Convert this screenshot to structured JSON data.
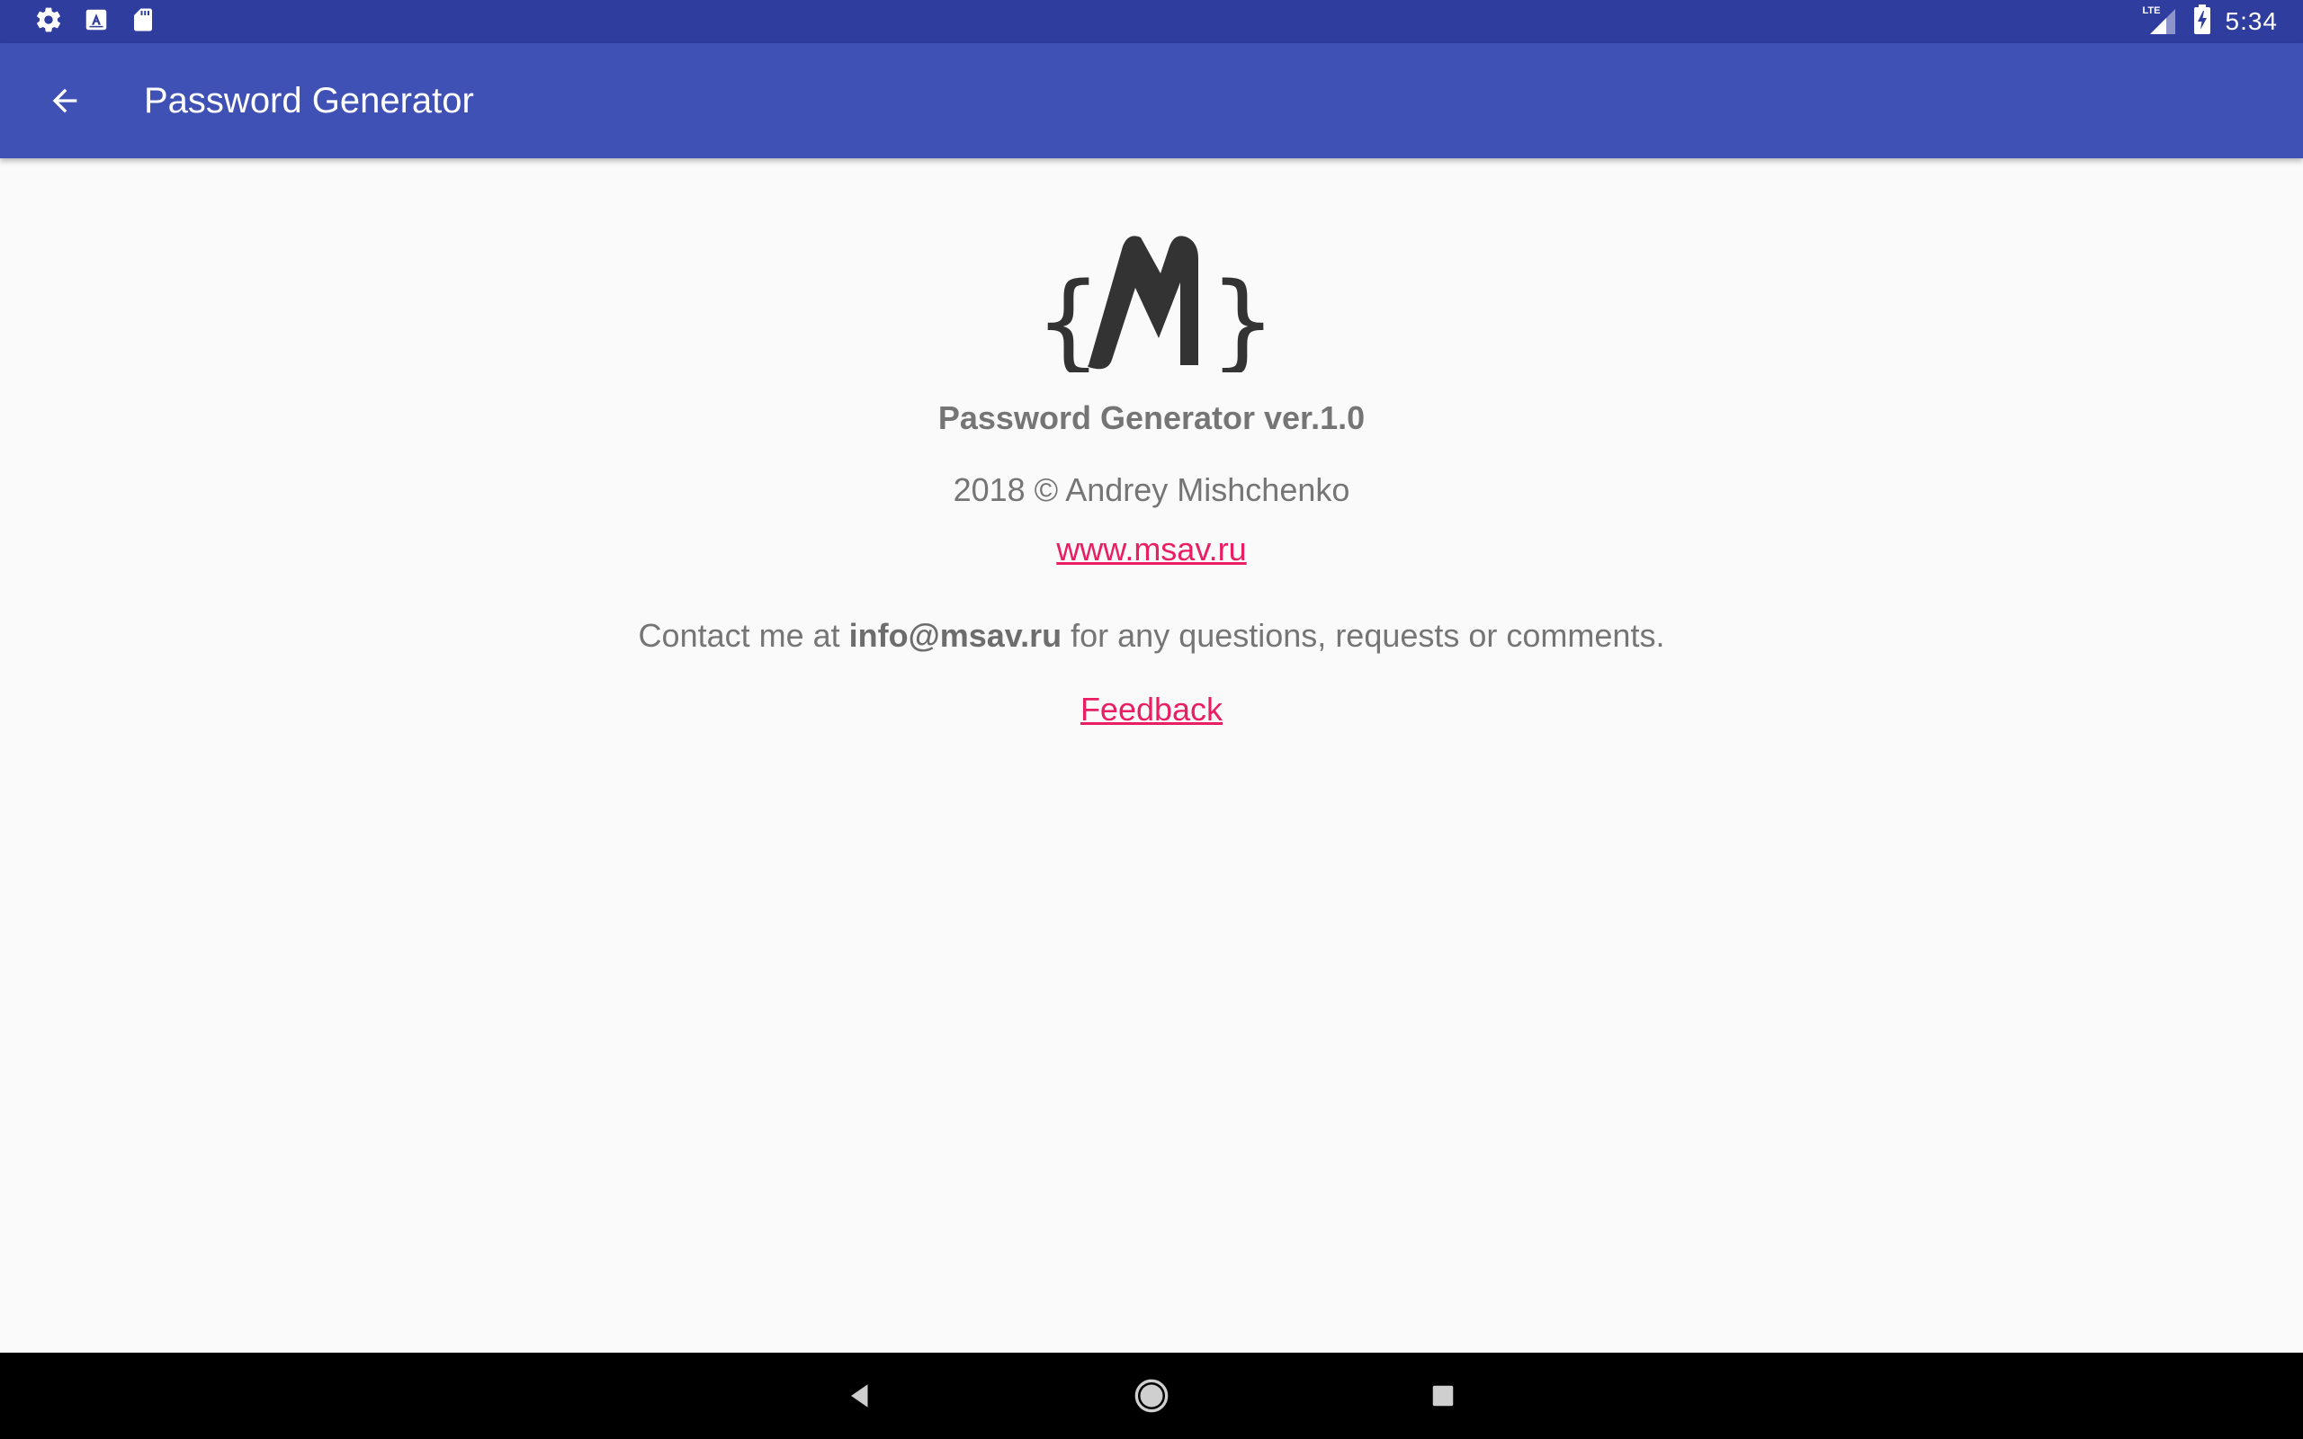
{
  "status_bar": {
    "time": "5:34",
    "network_label": "LTE",
    "left_icons": [
      "settings-icon",
      "app-store-icon",
      "sd-card-icon"
    ],
    "right_icons": [
      "signal-icon",
      "battery-charging-icon"
    ]
  },
  "app_bar": {
    "title": "Password Generator",
    "back_icon": "arrow-back-icon"
  },
  "about": {
    "logo_text": "M",
    "version": "Password Generator ver.1.0",
    "copyright": "2018 © Andrey Mishchenko",
    "website": "www.msav.ru",
    "contact_prefix": "Contact me at ",
    "contact_email": "info@msav.ru",
    "contact_suffix": " for any questions, requests or comments.",
    "feedback": "Feedback"
  },
  "nav_bar": {
    "buttons": [
      "back-nav-icon",
      "home-nav-icon",
      "recents-nav-icon"
    ]
  },
  "colors": {
    "status_bar": "#2f3d9f",
    "app_bar": "#3f51b5",
    "background": "#fafafa",
    "text": "#757575",
    "link": "#e91e63",
    "nav_bar": "#000000"
  }
}
